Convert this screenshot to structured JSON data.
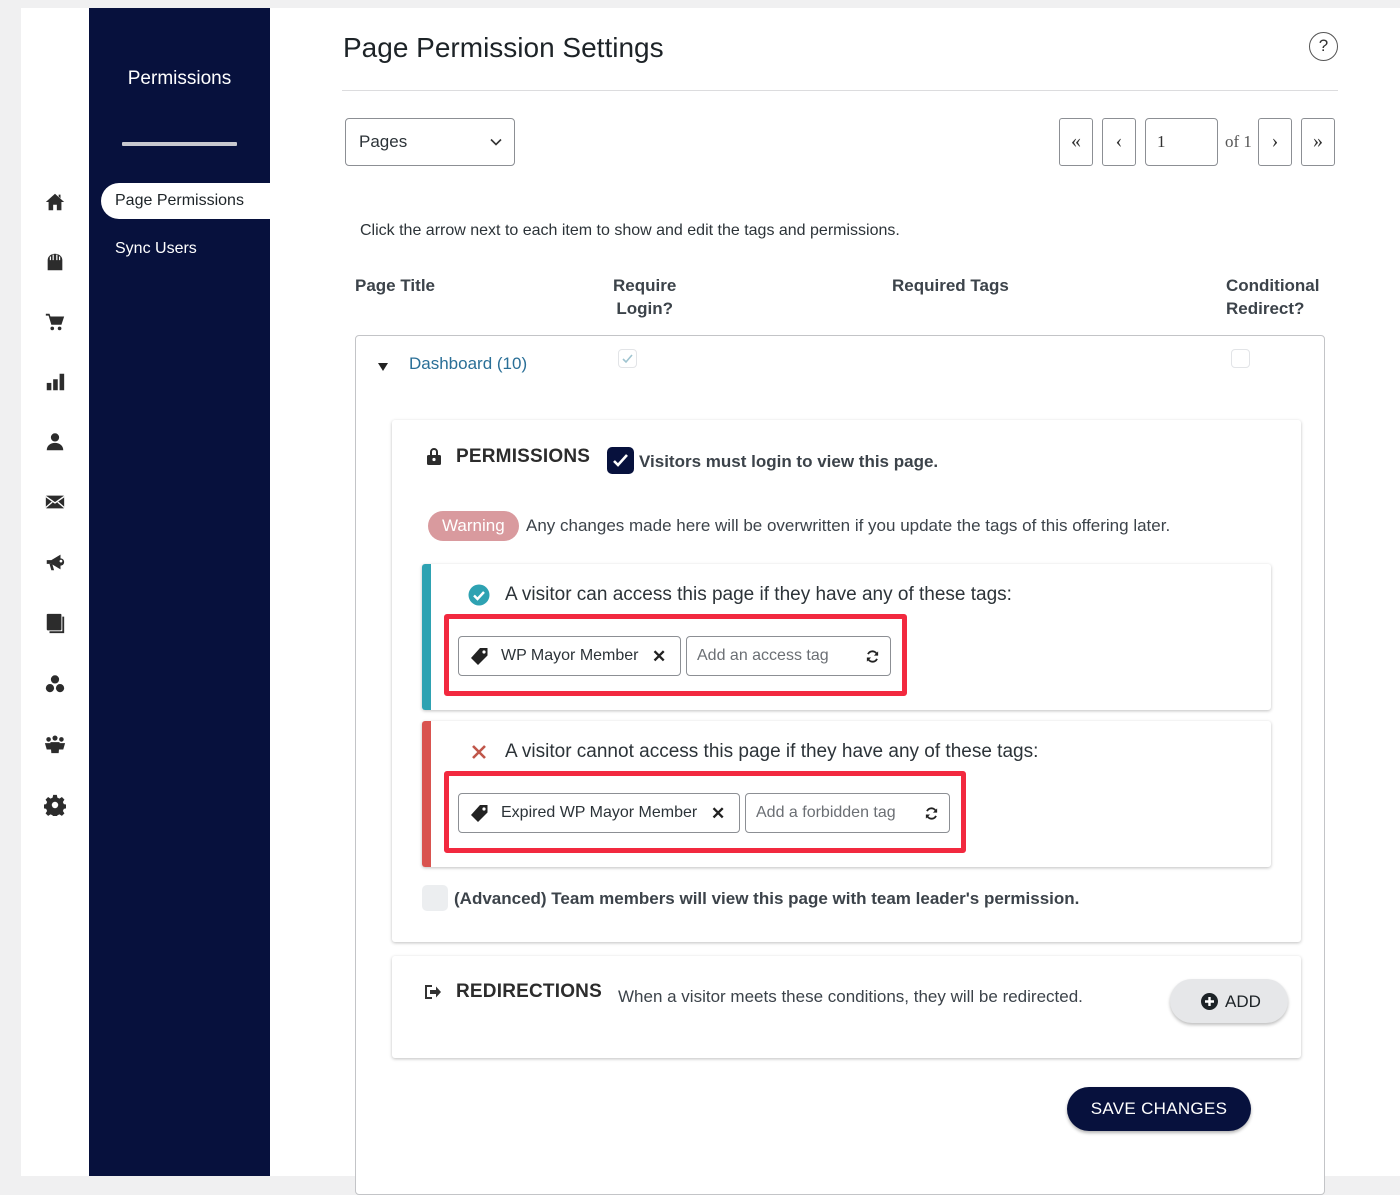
{
  "icon_bar": [
    {
      "name": "home-icon"
    },
    {
      "name": "store-icon"
    },
    {
      "name": "cart-icon"
    },
    {
      "name": "reports-icon"
    },
    {
      "name": "user-icon"
    },
    {
      "name": "email-icon"
    },
    {
      "name": "megaphone-icon"
    },
    {
      "name": "book-icon"
    },
    {
      "name": "circles-icon"
    },
    {
      "name": "team-icon"
    },
    {
      "name": "settings-gear-icon"
    }
  ],
  "sidebar": {
    "title": "Permissions",
    "items": [
      {
        "label": "Page Permissions",
        "active": true
      },
      {
        "label": "Sync Users",
        "active": false
      }
    ]
  },
  "header": {
    "title": "Page Permission Settings",
    "help_label": "?"
  },
  "filter": {
    "selected": "Pages"
  },
  "pagination": {
    "first": "«",
    "prev": "‹",
    "current_page": "1",
    "of_label": "of 1",
    "next": "›",
    "last": "»"
  },
  "instructions": "Click the arrow next to each item to show and edit the tags and permissions.",
  "columns": {
    "page_title": "Page Title",
    "require_login": "Require\nLogin?",
    "required_tags": "Required Tags",
    "conditional_redirect": "Conditional\nRedirect?"
  },
  "row": {
    "title": "Dashboard (10)",
    "require_login_checked": true,
    "conditional_redirect_checked": false,
    "expanded": true
  },
  "permissions": {
    "heading": "PERMISSIONS",
    "login_required_label": "Visitors must login to view this page.",
    "login_required_checked": true,
    "warning_badge": "Warning",
    "warning_text": "Any changes made here will be overwritten if you update the tags of this offering later.",
    "allow_rule": {
      "text": "A visitor can access this page if they have any of these tags:",
      "tags": [
        "WP Mayor Member"
      ],
      "placeholder": "Add an access tag",
      "accent": "#2ea2b2"
    },
    "deny_rule": {
      "text": "A visitor cannot access this page if they have any of these tags:",
      "tags": [
        "Expired WP Mayor Member"
      ],
      "placeholder": "Add a forbidden tag",
      "accent": "#d9534f"
    },
    "team_label": "(Advanced) Team members will view this page with team leader's permission.",
    "team_checked": false
  },
  "redirections": {
    "heading": "REDIRECTIONS",
    "description": "When a visitor meets these conditions, they will be redirected.",
    "add_label": "ADD"
  },
  "save_label": "SAVE CHANGES",
  "colors": {
    "sidebar_bg": "#07113d",
    "highlight": "#f2293f",
    "warning_badge": "#d99a9e",
    "link": "#2a6f97"
  }
}
